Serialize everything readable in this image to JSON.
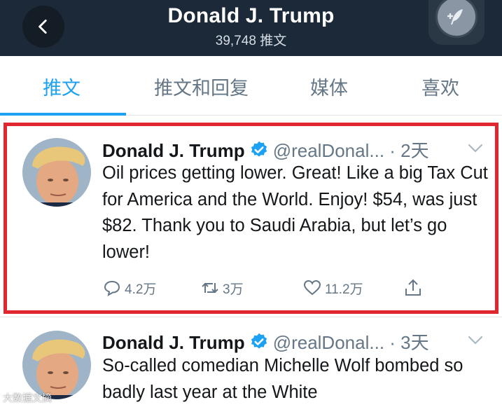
{
  "header": {
    "title": "Donald J. Trump",
    "tweet_count": "39,748 推文"
  },
  "tabs": [
    {
      "label": "推文",
      "active": true
    },
    {
      "label": "推文和回复",
      "active": false
    },
    {
      "label": "媒体",
      "active": false
    },
    {
      "label": "喜欢",
      "active": false
    }
  ],
  "tweets": [
    {
      "name": "Donald J. Trump",
      "handle": "@realDonal...",
      "time": "· 2天",
      "text": "Oil prices getting lower. Great! Like a big Tax Cut for America and the World. Enjoy! $54, was just $82. Thank you to Saudi Arabia, but let’s go lower!",
      "replies": "4.2万",
      "retweets": "3万",
      "likes": "11.2万"
    },
    {
      "name": "Donald J. Trump",
      "handle": "@realDonal...",
      "time": "· 3天",
      "text": "So-called comedian Michelle Wolf bombed so badly last year at the White"
    }
  ],
  "watermark": "大数据文摘",
  "colors": {
    "header_bg": "#1c2938",
    "accent": "#1da1f2",
    "highlight": "#e0262e"
  }
}
